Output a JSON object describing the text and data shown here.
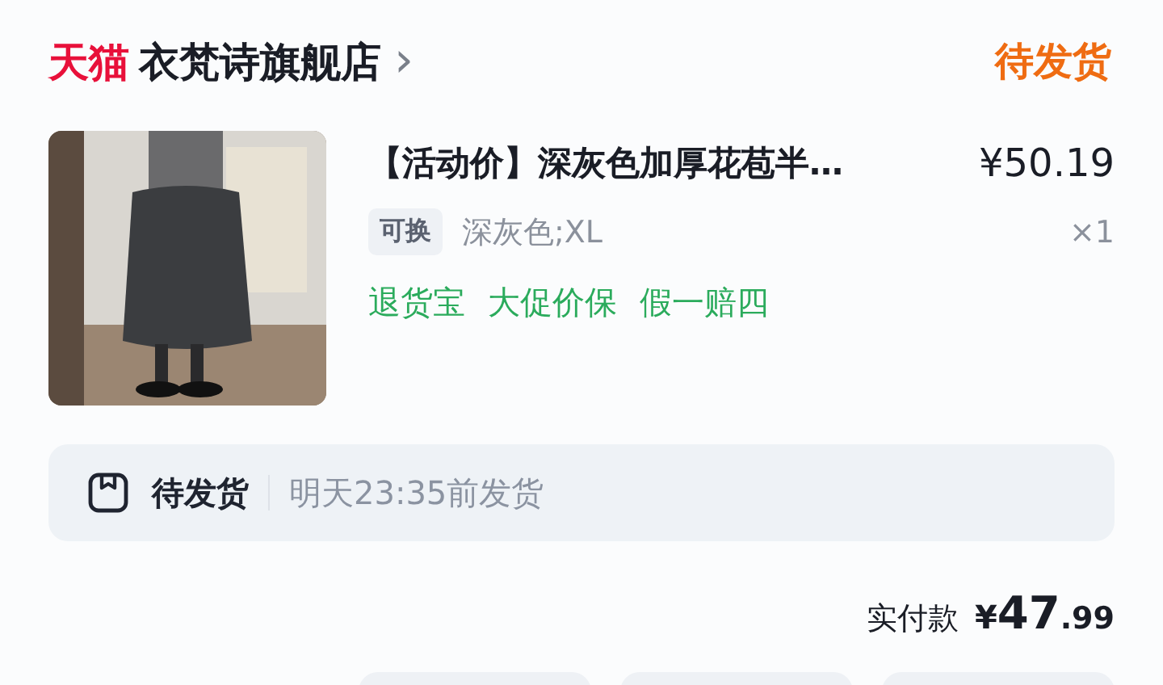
{
  "store": {
    "platform": "天猫",
    "name": "衣梵诗旗舰店",
    "chevron": "›"
  },
  "order_status": "待发货",
  "item": {
    "title": "【活动价】深灰色加厚花苞半…",
    "price": "¥50.19",
    "tag": "可换",
    "variant": "深灰色;XL",
    "quantity": "×1",
    "services": [
      "退货宝",
      "大促价保",
      "假一赔四"
    ]
  },
  "shipping": {
    "status": "待发货",
    "note": "明天23:35前发货"
  },
  "total": {
    "label": "实付款",
    "symbol": "¥",
    "main": "47",
    "cents": ".99"
  }
}
